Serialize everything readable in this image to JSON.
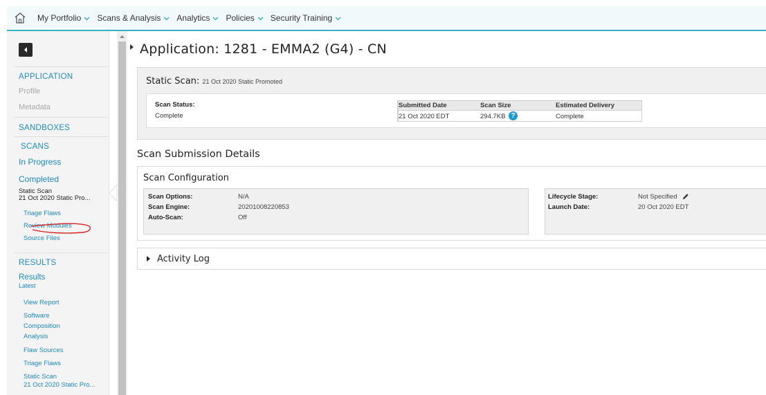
{
  "nav": {
    "items": [
      {
        "label": "My Portfolio"
      },
      {
        "label": "Scans & Analysis"
      },
      {
        "label": "Analytics"
      },
      {
        "label": "Policies"
      },
      {
        "label": "Security Training"
      }
    ],
    "home_icon": "home-icon",
    "chevron_icon": "chevron-down-icon",
    "accent": "#36b3c3"
  },
  "sidebar": {
    "application_heading": "APPLICATION",
    "profile": "Profile",
    "metadata": "Metadata",
    "sandboxes": "SANDBOXES",
    "scans_heading": "SCANS",
    "in_progress": "In Progress",
    "completed": "Completed",
    "current_scan_line1": "Static Scan",
    "current_scan_line2": "21 Oct 2020 Static Pro...",
    "triage_flaws": "Triage Flaws",
    "review_modules": "Review Modules",
    "source_files": "Source Files",
    "results_heading": "RESULTS",
    "results": "Results",
    "latest": "Latest",
    "view_report": "View Report",
    "sca_line1": "Software",
    "sca_line2": "Composition",
    "sca_line3": "Analysis",
    "flaw_sources": "Flaw Sources",
    "triage_flaws_2": "Triage Flaws",
    "static_scan_2_line1": "Static Scan",
    "static_scan_2_line2": "21 Oct 2020 Static Pro...",
    "link_color": "#1d8ac4"
  },
  "main": {
    "app_title": "Application: 1281 - EMMA2 (G4) - CN",
    "static_scan": {
      "label": "Static Scan:",
      "subtitle": "21 Oct 2020 Static Promoted",
      "status_label": "Scan Status:",
      "status_value": "Complete",
      "table_headers": [
        "Submitted Date",
        "Scan Size",
        "Estimated Delivery"
      ],
      "table_values": [
        "21 Oct 2020 EDT",
        "294.7KB",
        "Complete"
      ],
      "help_icon": "?"
    },
    "submission_title": "Scan Submission Details",
    "config": {
      "title": "Scan Configuration",
      "left": [
        {
          "label": "Scan Options:",
          "value": "N/A"
        },
        {
          "label": "Scan Engine:",
          "value": "20201008220853"
        },
        {
          "label": "Auto-Scan:",
          "value": "Off"
        }
      ],
      "right": [
        {
          "label": "Lifecycle Stage:",
          "value": "Not Specified"
        },
        {
          "label": "Launch Date:",
          "value": "20 Oct 2020 EDT"
        }
      ]
    },
    "activity_log": "Activity Log"
  }
}
